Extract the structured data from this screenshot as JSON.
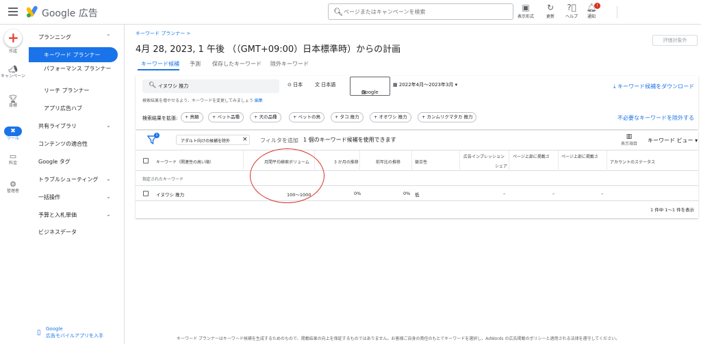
{
  "app": {
    "title": "Google 広告"
  },
  "search": {
    "placeholder": "ページまたはキャンペーンを検索"
  },
  "toolbar": [
    {
      "icon": "appearance-icon",
      "label": "表示形式"
    },
    {
      "icon": "refresh-icon",
      "label": "更新"
    },
    {
      "icon": "help-icon",
      "label": "ヘルプ"
    },
    {
      "icon": "bell-icon",
      "label": "通知",
      "badge": "!"
    }
  ],
  "rail": [
    {
      "icon": "create-icon",
      "label": "作成"
    },
    {
      "icon": "campaign-icon",
      "label": "キャンペーン"
    },
    {
      "icon": "trophy-icon",
      "label": "目標"
    },
    {
      "icon": "tools-icon",
      "label": "ツール",
      "active": true
    },
    {
      "icon": "billing-icon",
      "label": "料金"
    },
    {
      "icon": "admin-icon",
      "label": "管理者"
    }
  ],
  "sidenav": {
    "planning": "プランニング",
    "items": [
      "キーワード プランナー",
      "パフォーマンス プランナー",
      "リーチ プランナー",
      "アプリ広告ハブ"
    ],
    "sections": [
      "共有ライブラリ",
      "コンテンツの適合性",
      "Google タグ",
      "トラブルシューティング",
      "一括操作",
      "予算と入札単価",
      "ビジネスデータ"
    ],
    "mobile_line1": "Google",
    "mobile_line2": "広告モバイルアプリを入手"
  },
  "breadcrumb": "キーワード プランナー >",
  "page_title": "4月 28, 2023, 1 午後 （（GMT+09:00）日本標準時）からの計画",
  "eval_button": "評価対象外",
  "tabs": [
    "キーワード候補",
    "予測",
    "保存したキーワード",
    "除外キーワード"
  ],
  "filters": {
    "keyword": "イヌワシ 推力",
    "location": "日本",
    "language": "日本語",
    "network": "Google",
    "date_range": "2022年4月～2023年3月",
    "download": "キーワード候補をダウンロード",
    "hint": "検索結果を増やせるよう、キーワードを変更してみましょう",
    "hint_link": "編集",
    "expand_label": "検索結果を拡張:",
    "chips": [
      "鳥類",
      "ペット品種",
      "犬の品種",
      "ペットの鳥",
      "タコ 推力",
      "オオワシ 推力",
      "カンムリクマタカ 推力"
    ],
    "exclude": "不必要なキーワードを除外する"
  },
  "table": {
    "funnel_badge": "1",
    "adult_filter": "アダルト向けの候補を除外",
    "add_filter": "フィルタを追加",
    "using": "1 個のキーワード候補を使用できます",
    "columns_label": "表示項目",
    "view": "キーワード ビュー",
    "headers": [
      "キーワード（関連性の高い順）",
      "月間平均検索ボリューム",
      "3 か月の推移",
      "前年比の推移",
      "競合性",
      "広告インプレッション",
      "シェア",
      "ページ上部に掲載さ",
      "ページ上部に掲載さ",
      "アカウントのステータス"
    ],
    "group": "指定されたキーワード",
    "row": {
      "keyword": "イヌワシ 推力",
      "volume": "100～1000",
      "three_month": "0%",
      "yoy": "0%",
      "competition": "低",
      "share": "–",
      "top_low": "–",
      "top_high": "–"
    },
    "pager": "1 件中 1～1 件を表示"
  },
  "footer": "キーワード プランナーはキーワード候補を生成するためのもので、掲載結果の向上を保証するものではありません。お客様ご自身の責任のもとでキーワードを選択し、AdWords の広告掲載のポリシーと適用される法律を遵守してください。"
}
